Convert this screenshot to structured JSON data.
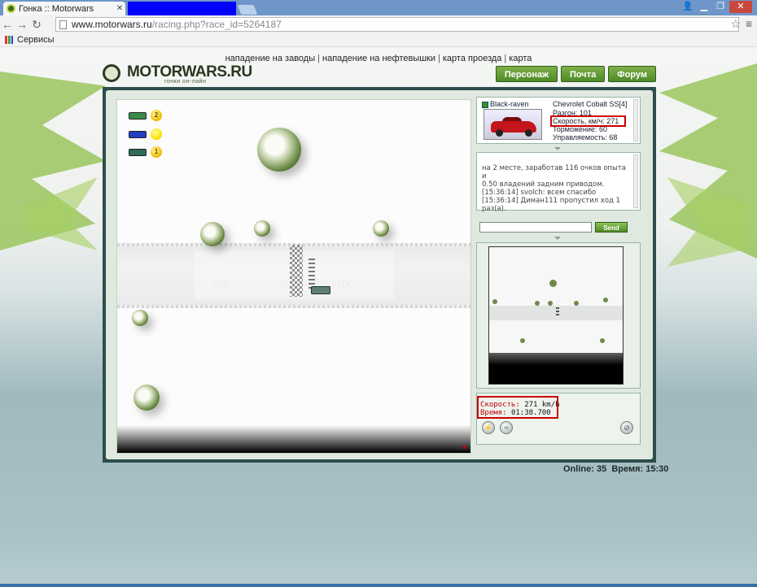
{
  "browser": {
    "tab_title": "Гонка :: Motorwars",
    "url_host": "www.motorwars.ru",
    "url_path": "/racing.php?race_id=5264187",
    "bookmark_label": "Сервисы"
  },
  "topnav": {
    "items": [
      "нападение на заводы",
      "нападение на нефтевышки",
      "карта проезда",
      "карта"
    ]
  },
  "header": {
    "logo": "MOTORWARS.RU",
    "logo_sub": "гонки он-лайн",
    "buttons": [
      "Персонаж",
      "Почта",
      "Форум"
    ]
  },
  "track": {
    "overlay_cols": [
      "Имя",
      "Опыт",
      "Статистика"
    ],
    "leaders": [
      {
        "color": "#3a8a4a",
        "badge": "2"
      },
      {
        "color": "#2440c0",
        "badge": ""
      },
      {
        "color": "#2f6a5a",
        "badge": "1"
      }
    ]
  },
  "player": {
    "name": "Black-raven",
    "car": "Chevrolet Cobalt SS[4]",
    "stats": [
      {
        "label": "Разгон",
        "value": "101"
      },
      {
        "label": "Скорость, км/ч",
        "value": "271"
      },
      {
        "label": "Торможение",
        "value": "60"
      },
      {
        "label": "Управляемость",
        "value": "68"
      }
    ]
  },
  "chat": {
    "lines": [
      "на 2 месте, заработав 116 очков опыта и",
      "0.50 владений задним приводом.",
      "[15:36:14] svolch: всем спасибо",
      "[15:36:14] Диман111 пропустил ход 1",
      "раз(а)."
    ],
    "input_value": "",
    "send_label": "Send"
  },
  "status": {
    "speed_label": "Скорость:",
    "speed_value": "271 km/h",
    "time_label": "Время:",
    "time_value": "01:38.700"
  },
  "footer": {
    "online_label": "Online:",
    "online_value": "35",
    "time_label": "Время:",
    "time_value": "15:30"
  },
  "colors": {
    "highlight": "#cc0000",
    "frame": "#2e4d4c",
    "button_green": "#4f8a28"
  }
}
